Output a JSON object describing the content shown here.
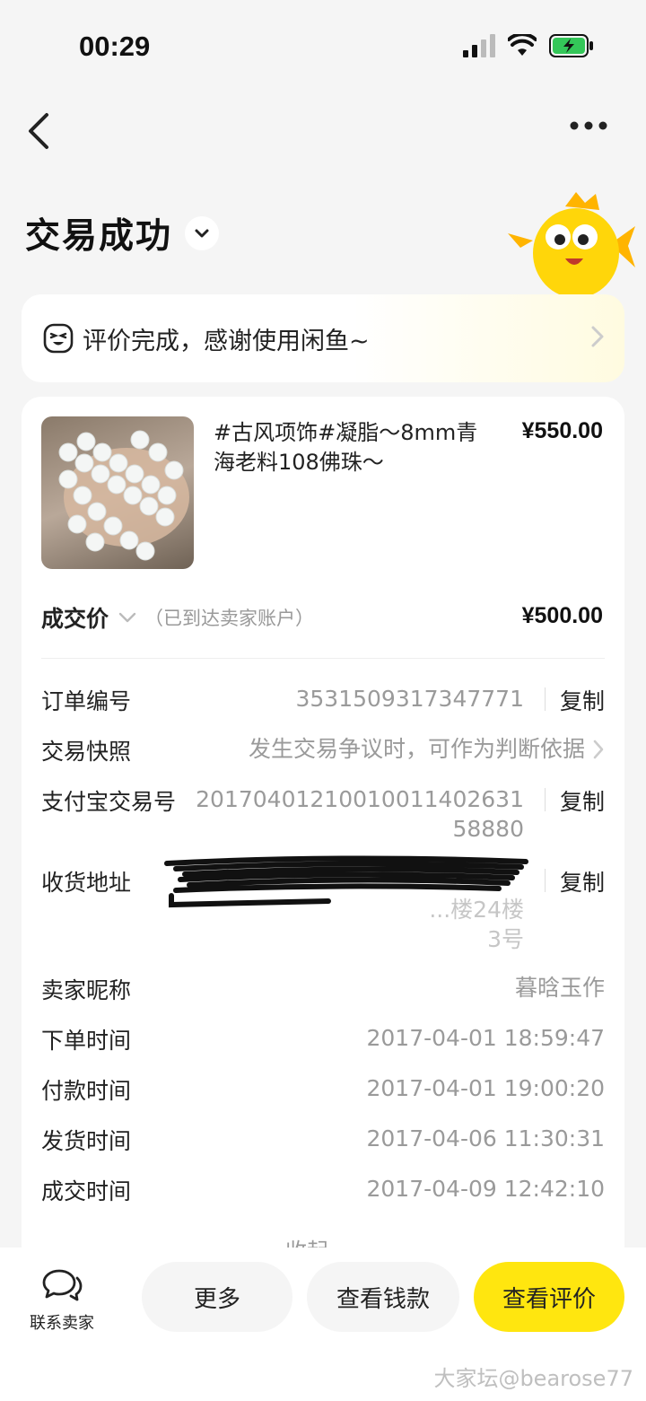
{
  "status_bar": {
    "time": "00:29"
  },
  "page": {
    "title": "交易成功"
  },
  "review_banner": {
    "text": "评价完成，感谢使用闲鱼~"
  },
  "product": {
    "title": "#古风项饰#凝脂～8mm青海老料108佛珠～",
    "price": "¥550.00"
  },
  "deal": {
    "label": "成交价",
    "note": "（已到达卖家账户）",
    "price": "¥500.00"
  },
  "details": {
    "order_no": {
      "label": "订单编号",
      "value": "3531509317347771",
      "action": "复制"
    },
    "snapshot": {
      "label": "交易快照",
      "value": "发生交易争议时，可作为判断依据"
    },
    "alipay_no": {
      "label": "支付宝交易号",
      "value_line1": "20170401210010011402631",
      "value_line2": "58880",
      "action": "复制"
    },
    "address": {
      "label": "收货地址",
      "value_line1": "...楼24楼",
      "value_line2": "3号",
      "action": "复制"
    },
    "seller_nick": {
      "label": "卖家昵称",
      "value": "暮晗玉作"
    },
    "order_time": {
      "label": "下单时间",
      "value": "2017-04-01 18:59:47"
    },
    "pay_time": {
      "label": "付款时间",
      "value": "2017-04-01 19:00:20"
    },
    "ship_time": {
      "label": "发货时间",
      "value": "2017-04-06 11:30:31"
    },
    "deal_time": {
      "label": "成交时间",
      "value": "2017-04-09 12:42:10"
    }
  },
  "collapse": {
    "label": "收起"
  },
  "bottom_bar": {
    "contact_label": "联系卖家",
    "more_label": "更多",
    "view_money_label": "查看钱款",
    "view_review_label": "查看评价"
  },
  "watermark": "大家坛@bearose77",
  "colors": {
    "accent_yellow": "#ffe60f",
    "background": "#f5f5f5",
    "muted_text": "#9a9a9a"
  }
}
